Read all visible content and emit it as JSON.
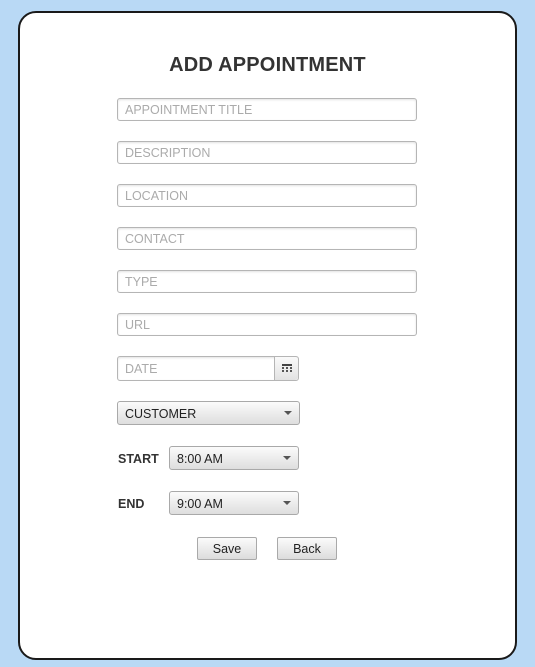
{
  "form": {
    "title": "ADD APPOINTMENT",
    "fields": {
      "title_placeholder": "APPOINTMENT TITLE",
      "description_placeholder": "DESCRIPTION",
      "location_placeholder": "LOCATION",
      "contact_placeholder": "CONTACT",
      "type_placeholder": "TYPE",
      "url_placeholder": "URL",
      "date_placeholder": "DATE"
    },
    "customer_select": {
      "value": "CUSTOMER"
    },
    "start": {
      "label": "START",
      "value": "8:00 AM"
    },
    "end": {
      "label": "END",
      "value": "9:00 AM"
    },
    "buttons": {
      "save": "Save",
      "back": "Back"
    }
  },
  "colors": {
    "page_background": "#b9d9f5",
    "card_background": "#ffffff",
    "card_border": "#1a1a1a"
  }
}
